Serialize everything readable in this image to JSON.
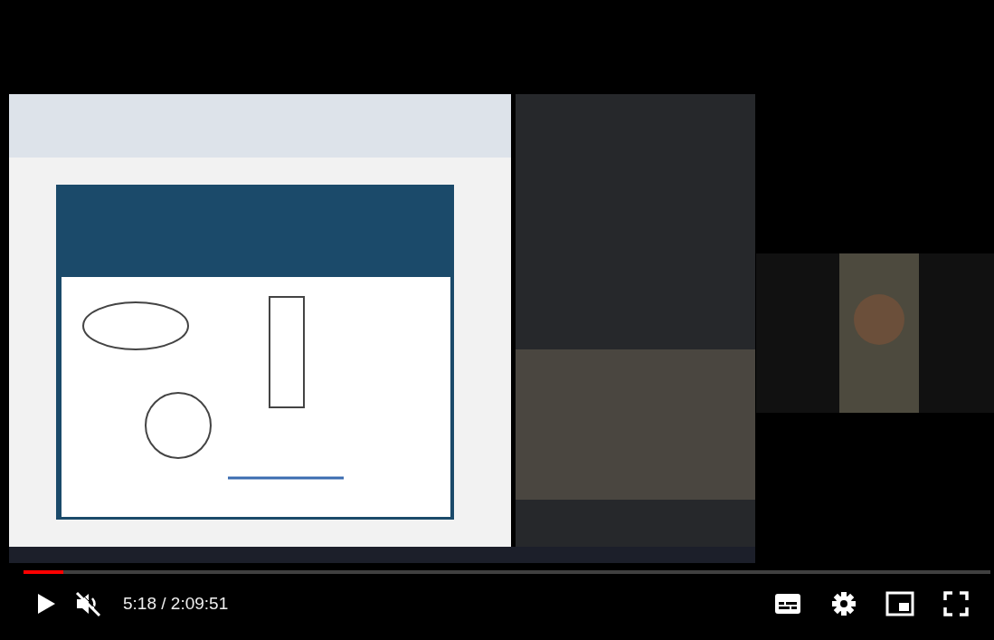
{
  "player": {
    "playing": false,
    "muted": true,
    "progress": {
      "level": 0.041
    },
    "time": "5:18 / 2:09:51"
  }
}
